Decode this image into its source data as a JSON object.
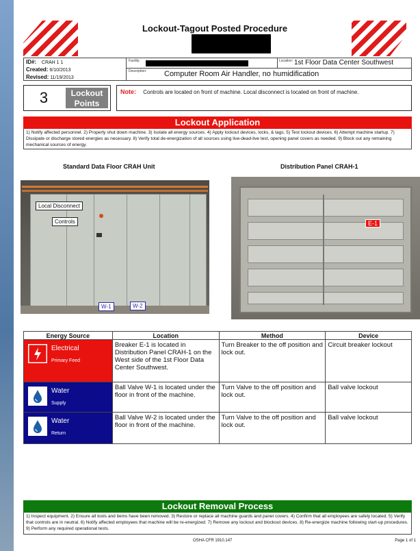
{
  "title": "Lockout-Tagout Posted Procedure",
  "info": {
    "id_label": "ID#:",
    "id_value": "CRAH 1 1",
    "created_label": "Created:",
    "created_value": "6/10/2013",
    "revised_label": "Revised:",
    "revised_value": "11/19/2013",
    "facility_label": "Facility:",
    "location_label": "Location:",
    "location_value": "1st Floor Data Center Southwest",
    "description_label": "Description:",
    "description_value": "Computer Room Air Handler, no humidification"
  },
  "points": {
    "count": "3",
    "label_line1": "Lockout",
    "label_line2": "Points"
  },
  "note": {
    "label": "Note:",
    "text": "Controls are located on front of machine.  Local disconnect is located on front of machine."
  },
  "lockout_application": {
    "title": "Lockout Application",
    "steps": "1) Notify affected personnel. 2) Properly shut down machine. 3) Isolate all energy sources. 4) Apply lockout devices, locks, & tags. 5) Test lockout devices. 6) Attempt machine startup. 7) Dissipate or discharge stored energies as necessary. 8) Verify total de-energization of all sources using live-dead-live test, opening panel covers as needed. 9) Block out any remaining mechanical sources of energy."
  },
  "photos": {
    "left_caption": "Standard Data Floor CRAH Unit",
    "right_caption": "Distribution Panel CRAH-1",
    "left_tags": {
      "local_disconnect": "Local Disconnect",
      "controls": "Controls",
      "w1": "W-1",
      "w2": "W-2"
    },
    "right_tags": {
      "e1": "E-1"
    }
  },
  "table": {
    "headers": [
      "Energy Source",
      "Location",
      "Method",
      "Device"
    ],
    "rows": [
      {
        "source": "Electrical",
        "sub": "Primary Feed",
        "color": "#e8130f",
        "icon": "electrical-hazard-icon",
        "location": "Breaker E-1 is located in Distribution Panel CRAH-1 on the West side of the 1st Floor Data Center Southwest.",
        "method": "Turn Breaker to the off position and lock out.",
        "device": "Circuit breaker lockout"
      },
      {
        "source": "Water",
        "sub": "Supply",
        "color": "#0b0b8c",
        "icon": "water-drop-icon",
        "location": "Ball Valve W-1 is located under the floor in front of the machine.",
        "method": "Turn Valve to the off position and lock out.",
        "device": "Ball valve lockout"
      },
      {
        "source": "Water",
        "sub": "Return",
        "color": "#0b0b8c",
        "icon": "water-drop-icon",
        "location": "Ball Valve W-2 is located under the floor in front of the machine.",
        "method": "Turn Valve to the off position and lock out.",
        "device": "Ball valve lockout"
      }
    ]
  },
  "removal": {
    "title": "Lockout Removal Process",
    "steps": "1) Inspect equipment. 2) Ensure all tools and items have been removed. 3) Restore or replace all machine guards and panel covers. 4) Confirm that all employees are safely located. 5) Verify that controls are in neutral. 6) Notify affected employees that machine will be re-energized. 7) Remove any lockout and blockout devices. 8) Re-energize machine following start-up procedures. 9) Perform any required operational tests."
  },
  "footer": {
    "center": "OSHA CFR 1910.147",
    "right": "Page 1 of 1"
  }
}
